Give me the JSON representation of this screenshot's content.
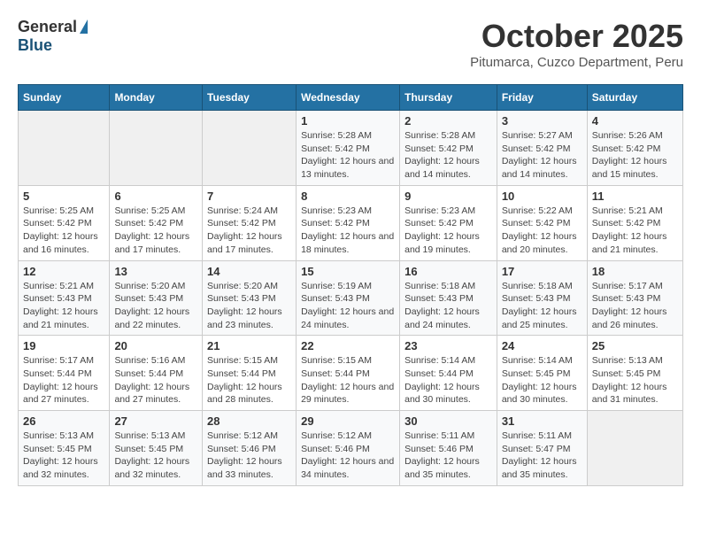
{
  "header": {
    "logo_general": "General",
    "logo_blue": "Blue",
    "month": "October 2025",
    "location": "Pitumarca, Cuzco Department, Peru"
  },
  "weekdays": [
    "Sunday",
    "Monday",
    "Tuesday",
    "Wednesday",
    "Thursday",
    "Friday",
    "Saturday"
  ],
  "weeks": [
    [
      {
        "day": "",
        "sunrise": "",
        "sunset": "",
        "daylight": ""
      },
      {
        "day": "",
        "sunrise": "",
        "sunset": "",
        "daylight": ""
      },
      {
        "day": "",
        "sunrise": "",
        "sunset": "",
        "daylight": ""
      },
      {
        "day": "1",
        "sunrise": "Sunrise: 5:28 AM",
        "sunset": "Sunset: 5:42 PM",
        "daylight": "Daylight: 12 hours and 13 minutes."
      },
      {
        "day": "2",
        "sunrise": "Sunrise: 5:28 AM",
        "sunset": "Sunset: 5:42 PM",
        "daylight": "Daylight: 12 hours and 14 minutes."
      },
      {
        "day": "3",
        "sunrise": "Sunrise: 5:27 AM",
        "sunset": "Sunset: 5:42 PM",
        "daylight": "Daylight: 12 hours and 14 minutes."
      },
      {
        "day": "4",
        "sunrise": "Sunrise: 5:26 AM",
        "sunset": "Sunset: 5:42 PM",
        "daylight": "Daylight: 12 hours and 15 minutes."
      }
    ],
    [
      {
        "day": "5",
        "sunrise": "Sunrise: 5:25 AM",
        "sunset": "Sunset: 5:42 PM",
        "daylight": "Daylight: 12 hours and 16 minutes."
      },
      {
        "day": "6",
        "sunrise": "Sunrise: 5:25 AM",
        "sunset": "Sunset: 5:42 PM",
        "daylight": "Daylight: 12 hours and 17 minutes."
      },
      {
        "day": "7",
        "sunrise": "Sunrise: 5:24 AM",
        "sunset": "Sunset: 5:42 PM",
        "daylight": "Daylight: 12 hours and 17 minutes."
      },
      {
        "day": "8",
        "sunrise": "Sunrise: 5:23 AM",
        "sunset": "Sunset: 5:42 PM",
        "daylight": "Daylight: 12 hours and 18 minutes."
      },
      {
        "day": "9",
        "sunrise": "Sunrise: 5:23 AM",
        "sunset": "Sunset: 5:42 PM",
        "daylight": "Daylight: 12 hours and 19 minutes."
      },
      {
        "day": "10",
        "sunrise": "Sunrise: 5:22 AM",
        "sunset": "Sunset: 5:42 PM",
        "daylight": "Daylight: 12 hours and 20 minutes."
      },
      {
        "day": "11",
        "sunrise": "Sunrise: 5:21 AM",
        "sunset": "Sunset: 5:42 PM",
        "daylight": "Daylight: 12 hours and 21 minutes."
      }
    ],
    [
      {
        "day": "12",
        "sunrise": "Sunrise: 5:21 AM",
        "sunset": "Sunset: 5:43 PM",
        "daylight": "Daylight: 12 hours and 21 minutes."
      },
      {
        "day": "13",
        "sunrise": "Sunrise: 5:20 AM",
        "sunset": "Sunset: 5:43 PM",
        "daylight": "Daylight: 12 hours and 22 minutes."
      },
      {
        "day": "14",
        "sunrise": "Sunrise: 5:20 AM",
        "sunset": "Sunset: 5:43 PM",
        "daylight": "Daylight: 12 hours and 23 minutes."
      },
      {
        "day": "15",
        "sunrise": "Sunrise: 5:19 AM",
        "sunset": "Sunset: 5:43 PM",
        "daylight": "Daylight: 12 hours and 24 minutes."
      },
      {
        "day": "16",
        "sunrise": "Sunrise: 5:18 AM",
        "sunset": "Sunset: 5:43 PM",
        "daylight": "Daylight: 12 hours and 24 minutes."
      },
      {
        "day": "17",
        "sunrise": "Sunrise: 5:18 AM",
        "sunset": "Sunset: 5:43 PM",
        "daylight": "Daylight: 12 hours and 25 minutes."
      },
      {
        "day": "18",
        "sunrise": "Sunrise: 5:17 AM",
        "sunset": "Sunset: 5:43 PM",
        "daylight": "Daylight: 12 hours and 26 minutes."
      }
    ],
    [
      {
        "day": "19",
        "sunrise": "Sunrise: 5:17 AM",
        "sunset": "Sunset: 5:44 PM",
        "daylight": "Daylight: 12 hours and 27 minutes."
      },
      {
        "day": "20",
        "sunrise": "Sunrise: 5:16 AM",
        "sunset": "Sunset: 5:44 PM",
        "daylight": "Daylight: 12 hours and 27 minutes."
      },
      {
        "day": "21",
        "sunrise": "Sunrise: 5:15 AM",
        "sunset": "Sunset: 5:44 PM",
        "daylight": "Daylight: 12 hours and 28 minutes."
      },
      {
        "day": "22",
        "sunrise": "Sunrise: 5:15 AM",
        "sunset": "Sunset: 5:44 PM",
        "daylight": "Daylight: 12 hours and 29 minutes."
      },
      {
        "day": "23",
        "sunrise": "Sunrise: 5:14 AM",
        "sunset": "Sunset: 5:44 PM",
        "daylight": "Daylight: 12 hours and 30 minutes."
      },
      {
        "day": "24",
        "sunrise": "Sunrise: 5:14 AM",
        "sunset": "Sunset: 5:45 PM",
        "daylight": "Daylight: 12 hours and 30 minutes."
      },
      {
        "day": "25",
        "sunrise": "Sunrise: 5:13 AM",
        "sunset": "Sunset: 5:45 PM",
        "daylight": "Daylight: 12 hours and 31 minutes."
      }
    ],
    [
      {
        "day": "26",
        "sunrise": "Sunrise: 5:13 AM",
        "sunset": "Sunset: 5:45 PM",
        "daylight": "Daylight: 12 hours and 32 minutes."
      },
      {
        "day": "27",
        "sunrise": "Sunrise: 5:13 AM",
        "sunset": "Sunset: 5:45 PM",
        "daylight": "Daylight: 12 hours and 32 minutes."
      },
      {
        "day": "28",
        "sunrise": "Sunrise: 5:12 AM",
        "sunset": "Sunset: 5:46 PM",
        "daylight": "Daylight: 12 hours and 33 minutes."
      },
      {
        "day": "29",
        "sunrise": "Sunrise: 5:12 AM",
        "sunset": "Sunset: 5:46 PM",
        "daylight": "Daylight: 12 hours and 34 minutes."
      },
      {
        "day": "30",
        "sunrise": "Sunrise: 5:11 AM",
        "sunset": "Sunset: 5:46 PM",
        "daylight": "Daylight: 12 hours and 35 minutes."
      },
      {
        "day": "31",
        "sunrise": "Sunrise: 5:11 AM",
        "sunset": "Sunset: 5:47 PM",
        "daylight": "Daylight: 12 hours and 35 minutes."
      },
      {
        "day": "",
        "sunrise": "",
        "sunset": "",
        "daylight": ""
      }
    ]
  ]
}
